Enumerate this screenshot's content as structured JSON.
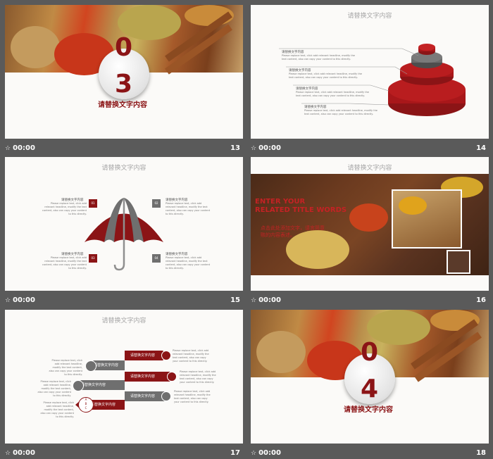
{
  "colors": {
    "accent": "#8b1416",
    "gray": "#6f6f6f",
    "bg": "#5a5a5a"
  },
  "slides": [
    {
      "number": "13",
      "time": "00:00",
      "section_number": "0",
      "section_number2": "3",
      "section_title": "请替换文字内容"
    },
    {
      "number": "14",
      "time": "00:00",
      "title": "请替换文字内容",
      "items": [
        {
          "label": "请替换文字内容",
          "text": "Please replace text, click add relevant headline, modify the text content, also can copy your content to this directly."
        },
        {
          "label": "请替换文字内容",
          "text": "Please replace text, click add relevant headline, modify the text content, also can copy your content to this directly."
        },
        {
          "label": "请替换文字内容",
          "text": "Please replace text, click add relevant headline, modify the text content, also can copy your content to this directly."
        },
        {
          "label": "请替换文字内容",
          "text": "Please replace text, click add relevant headline, modify the text content, also can copy your content to this directly."
        }
      ]
    },
    {
      "number": "15",
      "time": "00:00",
      "title": "请替换文字内容",
      "boxes": [
        "01",
        "02",
        "03",
        "04"
      ],
      "items": [
        {
          "label": "请替换文字内容",
          "text": "Please replace text, click add relevant headline, modify the text content, also can copy your content to this directly."
        },
        {
          "label": "请替换文字内容",
          "text": "Please replace text, click add relevant headline, modify the text content, also can copy your content to this directly."
        },
        {
          "label": "请替换文字内容",
          "text": "Please replace text, click add relevant headline, modify the text content, also can copy your content to this directly."
        },
        {
          "label": "请替换文字内容",
          "text": "Please replace text, click add relevant headline, modify the text content, also can copy your content to this directly."
        }
      ]
    },
    {
      "number": "16",
      "time": "00:00",
      "title": "请替换文字内容",
      "headline1": "ENTER YOUR",
      "headline2": "RELATED TITLE WORDS",
      "subtitle1": "点击此处添加文字，请言简意",
      "subtitle2": "赅的内容表述。"
    },
    {
      "number": "17",
      "time": "00:00",
      "title": "请替换文字内容",
      "arrows": [
        "请替换文字内容",
        "请替换文字内容",
        "请替换文字内容",
        "请替换文字内容",
        "请替换文字内容",
        "请替换文字内容"
      ],
      "icon_letters": [
        "A",
        "B",
        "C"
      ],
      "text": "Please replace text, click add relevant headline, modify the text content, also can copy your content to this directly."
    },
    {
      "number": "18",
      "time": "00:00",
      "section_number": "0",
      "section_number2": "4",
      "section_title": "请替换文字内容"
    }
  ],
  "icons": {
    "star": "☆"
  }
}
